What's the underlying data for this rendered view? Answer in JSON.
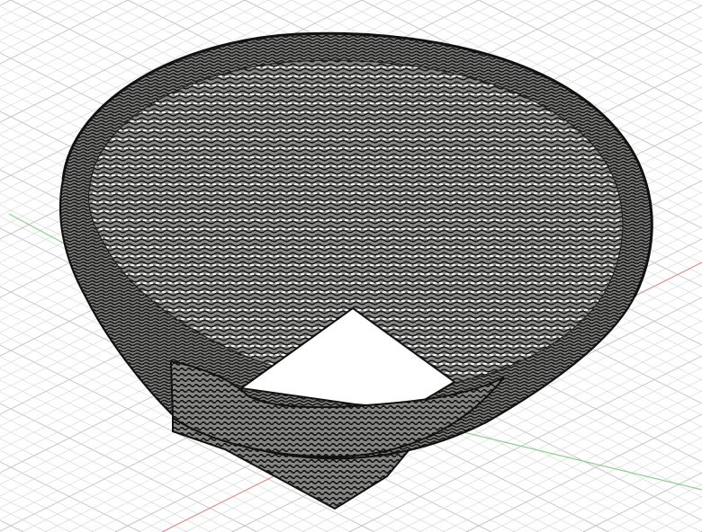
{
  "viewport": {
    "background": "#ffffff",
    "grid_color": "#d9d9d9",
    "grid_major_color": "#c4c4c4",
    "x_axis_color": "#e08a8a",
    "y_axis_color": "#8ad18a"
  },
  "model": {
    "name": "mesh-bowl",
    "fill_color": "#8a8a88",
    "line_color": "#111111",
    "opening_color": "#ffffff"
  }
}
